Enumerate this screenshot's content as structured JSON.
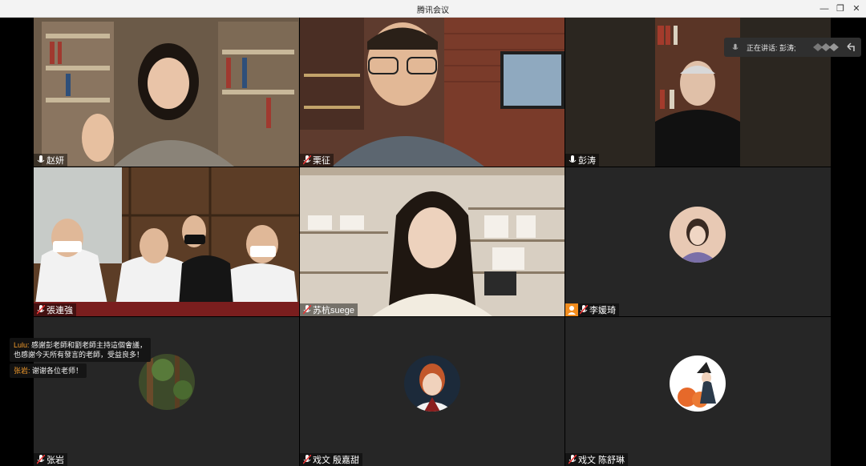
{
  "window": {
    "title": "腾讯会议"
  },
  "speaking_banner": {
    "label": "正在讲话: 彭涛;"
  },
  "participants": [
    {
      "name": "赵妍"
    },
    {
      "name": "栗征"
    },
    {
      "name": "彭涛"
    },
    {
      "name": "張連強"
    },
    {
      "name": "苏杭suege"
    },
    {
      "name": "李媛琦"
    },
    {
      "name": "张岩"
    },
    {
      "name": "戏文 殷嘉甜"
    },
    {
      "name": "戏文 陈舒琳"
    }
  ],
  "chat": [
    {
      "sender": "Lulu:",
      "line1": "感謝彭老師和劉老師主持這個會議，",
      "line2": "也感謝今天所有發言的老師，受益良多！"
    },
    {
      "sender": "张岩:",
      "line1": "谢谢各位老师！",
      "line2": ""
    }
  ],
  "colors": {
    "active_border": "#1fa35a",
    "chat_sender": "#f39b2b",
    "host_badge": "#f28c1d"
  }
}
